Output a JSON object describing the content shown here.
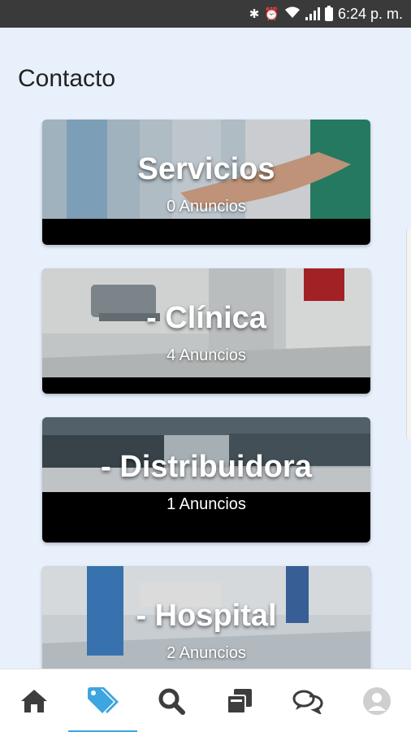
{
  "status_bar": {
    "time": "6:24 p. m.",
    "icons": [
      "bluetooth-icon",
      "alarm-icon",
      "wifi-icon",
      "signal-icon",
      "battery-icon"
    ]
  },
  "page": {
    "title": "Contacto"
  },
  "cards": [
    {
      "title": "Servicios",
      "count": "0 Anuncios"
    },
    {
      "title": "- Clínica",
      "count": "4 Anuncios"
    },
    {
      "title": "- Distribuidora",
      "count": "1 Anuncios"
    },
    {
      "title": "- Hospital",
      "count": "2 Anuncios"
    }
  ],
  "bottom_nav": {
    "items": [
      {
        "icon": "home-icon",
        "active": false
      },
      {
        "icon": "tag-icon",
        "active": true
      },
      {
        "icon": "search-icon",
        "active": false
      },
      {
        "icon": "collection-icon",
        "active": false
      },
      {
        "icon": "chat-icon",
        "active": false
      },
      {
        "icon": "profile-icon",
        "active": false
      }
    ],
    "colors": {
      "active": "#3da5e0",
      "inactive": "#3d3d3d",
      "profile": "#cfcfcf"
    }
  }
}
